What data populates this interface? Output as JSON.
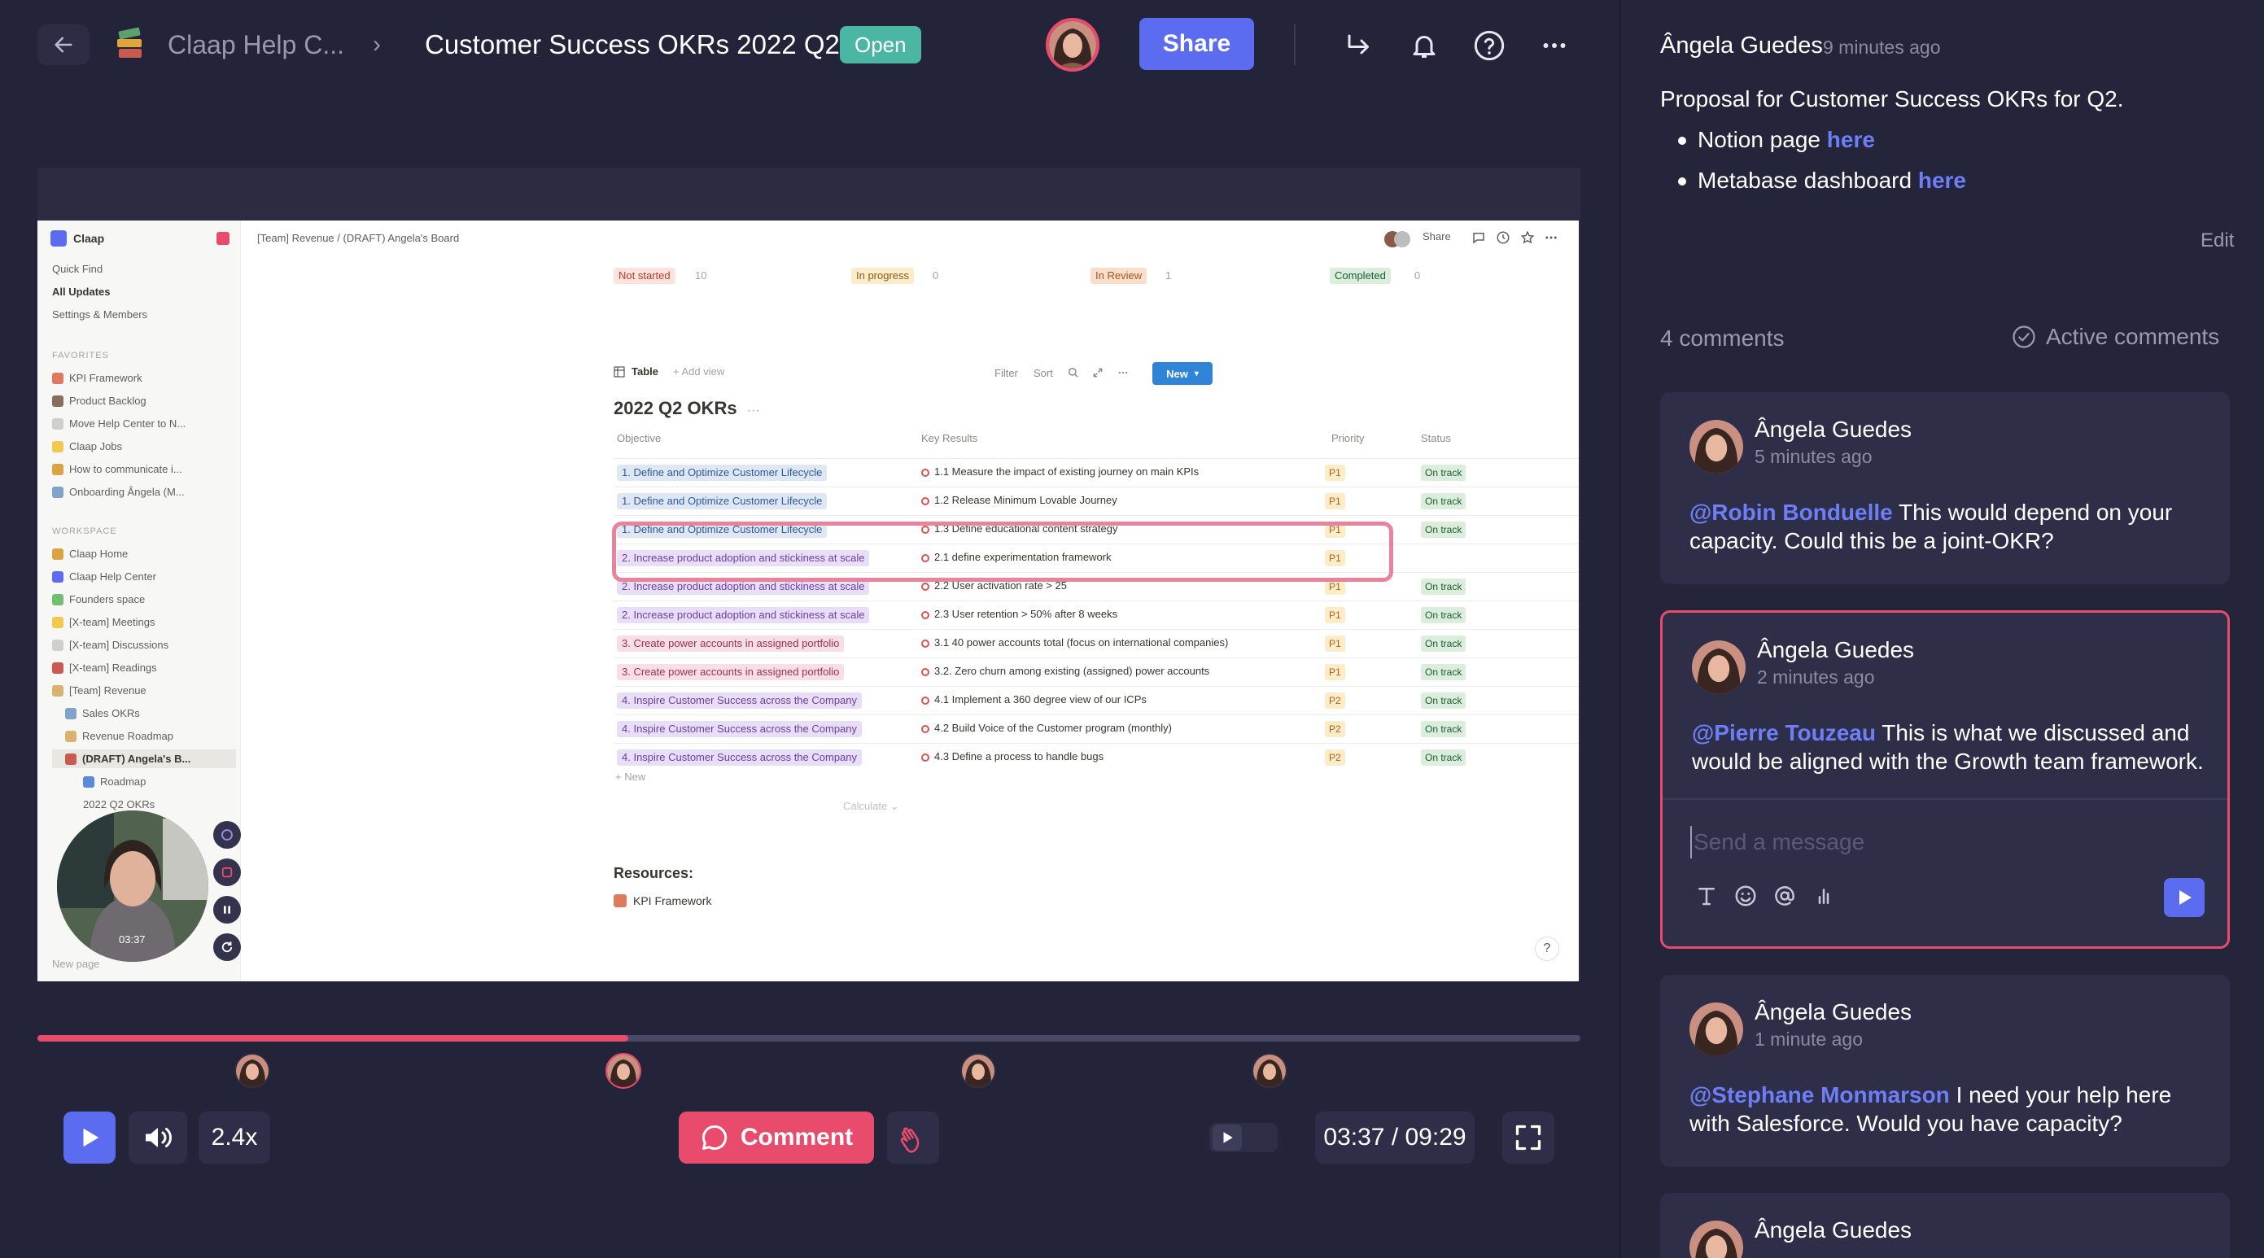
{
  "header": {
    "workspace": "Claap Help C...",
    "separator": "›",
    "title": "Customer Success OKRs 2022 Q2",
    "status": "Open",
    "share_label": "Share"
  },
  "screen": {
    "workspace_name": "Claap",
    "quick": [
      "Quick Find",
      "All Updates",
      "Settings & Members"
    ],
    "favorites_label": "FAVORITES",
    "favorites": [
      "KPI Framework",
      "Product Backlog",
      "Move Help Center to N...",
      "Claap Jobs",
      "How to communicate i...",
      "Onboarding Ângela (M..."
    ],
    "workspace_label": "WORKSPACE",
    "workspace_items": [
      "Claap Home",
      "Claap Help Center",
      "Founders space",
      "[X-team] Meetings",
      "[X-team] Discussions",
      "[X-team] Readings",
      "[Team] Revenue",
      "Sales OKRs",
      "Revenue Roadmap",
      "(DRAFT) Angela's B...",
      "Roadmap",
      "2022 Q2 OKRs"
    ],
    "new_page": "New page",
    "breadcrumb_a": "[Team] Revenue",
    "breadcrumb_sep": "/",
    "breadcrumb_b": "(DRAFT) Angela's Board",
    "top_share": "Share",
    "groups": [
      {
        "label": "Not started",
        "count": "10"
      },
      {
        "label": "In progress",
        "count": "0"
      },
      {
        "label": "In Review",
        "count": "1"
      },
      {
        "label": "Completed",
        "count": "0"
      }
    ],
    "view_tab": "Table",
    "add_view": "+ Add view",
    "filter": "Filter",
    "sort": "Sort",
    "new_btn": "New",
    "table_title": "2022 Q2 OKRs",
    "col_objective": "Objective",
    "col_kr": "Key Results",
    "col_priority": "Priority",
    "col_status": "Status",
    "rows": [
      {
        "obj": "1. Define and Optimize Customer Lifecycle",
        "kr": "1.1 Measure the impact of existing journey on main KPIs",
        "pri": "P1",
        "st": "On track"
      },
      {
        "obj": "1. Define and Optimize Customer Lifecycle",
        "kr": "1.2 Release Minimum Lovable Journey",
        "pri": "P1",
        "st": "On track"
      },
      {
        "obj": "1. Define and Optimize Customer Lifecycle",
        "kr": "1.3 Define educational content strategy",
        "pri": "P1",
        "st": "On track"
      },
      {
        "obj": "2. Increase product adoption and stickiness at scale",
        "kr": "2.1 define experimentation framework",
        "pri": "P1",
        "st": ""
      },
      {
        "obj": "2. Increase product adoption and stickiness at scale",
        "kr": "2.2 User activation rate > 25",
        "pri": "P1",
        "st": "On track"
      },
      {
        "obj": "2. Increase product adoption and stickiness at scale",
        "kr": "2.3 User retention > 50% after 8 weeks",
        "pri": "P1",
        "st": "On track"
      },
      {
        "obj": "3. Create power accounts in assigned portfolio",
        "kr": "3.1 40 power accounts total (focus on international companies)",
        "pri": "P1",
        "st": "On track"
      },
      {
        "obj": "3. Create power accounts in assigned portfolio",
        "kr": "3.2. Zero churn among existing (assigned) power accounts",
        "pri": "P1",
        "st": "On track"
      },
      {
        "obj": "4. Inspire Customer Success across the Company",
        "kr": "4.1 Implement a 360 degree view of our ICPs",
        "pri": "P2",
        "st": "On track"
      },
      {
        "obj": "4. Inspire Customer Success across the Company",
        "kr": "4.2 Build Voice of the Customer program (monthly)",
        "pri": "P2",
        "st": "On track"
      },
      {
        "obj": "4. Inspire Customer Success across the Company",
        "kr": "4.3 Define a process to handle bugs",
        "pri": "P2",
        "st": "On track"
      }
    ],
    "new_row": "+ New",
    "calculate": "Calculate ⌄",
    "resources": "Resources:",
    "kpi_link": "KPI Framework",
    "help": "?",
    "webcam_time": "03:37"
  },
  "player": {
    "progress": 0.383,
    "speed": "2.4x",
    "comment_label": "Comment",
    "time": "03:37 / 09:29"
  },
  "panel": {
    "author": "Ângela Guedes",
    "time": "9 minutes ago",
    "description": "Proposal for Customer Success OKRs for Q2.",
    "bullets": [
      {
        "text": "Notion page ",
        "link": "here"
      },
      {
        "text": "Metabase dashboard ",
        "link": "here"
      }
    ],
    "edit": "Edit",
    "count": "4 comments",
    "active_label": "Active comments",
    "comments": [
      {
        "name": "Ângela Guedes",
        "time": "5 minutes ago",
        "mention": "@Robin Bonduelle",
        "text": " This would depend on your capacity. Could this be a joint-OKR?"
      },
      {
        "name": "Ângela Guedes",
        "time": "2 minutes ago",
        "mention": "@Pierre Touzeau",
        "text": " This is what we discussed and would be aligned with the Growth team framework."
      },
      {
        "name": "Ângela Guedes",
        "time": "1 minute ago",
        "mention": "@Stephane Monmarson",
        "text": " I need your help here with Salesforce. Would you have capacity?"
      },
      {
        "name": "Ângela Guedes",
        "time": "",
        "mention": "",
        "text": ""
      }
    ],
    "input_placeholder": "Send a message"
  },
  "colors": {
    "accent": "#5b6cf0",
    "brand_red": "#e94b6c",
    "status_open": "#4bb6a4",
    "bg": "#232339"
  }
}
